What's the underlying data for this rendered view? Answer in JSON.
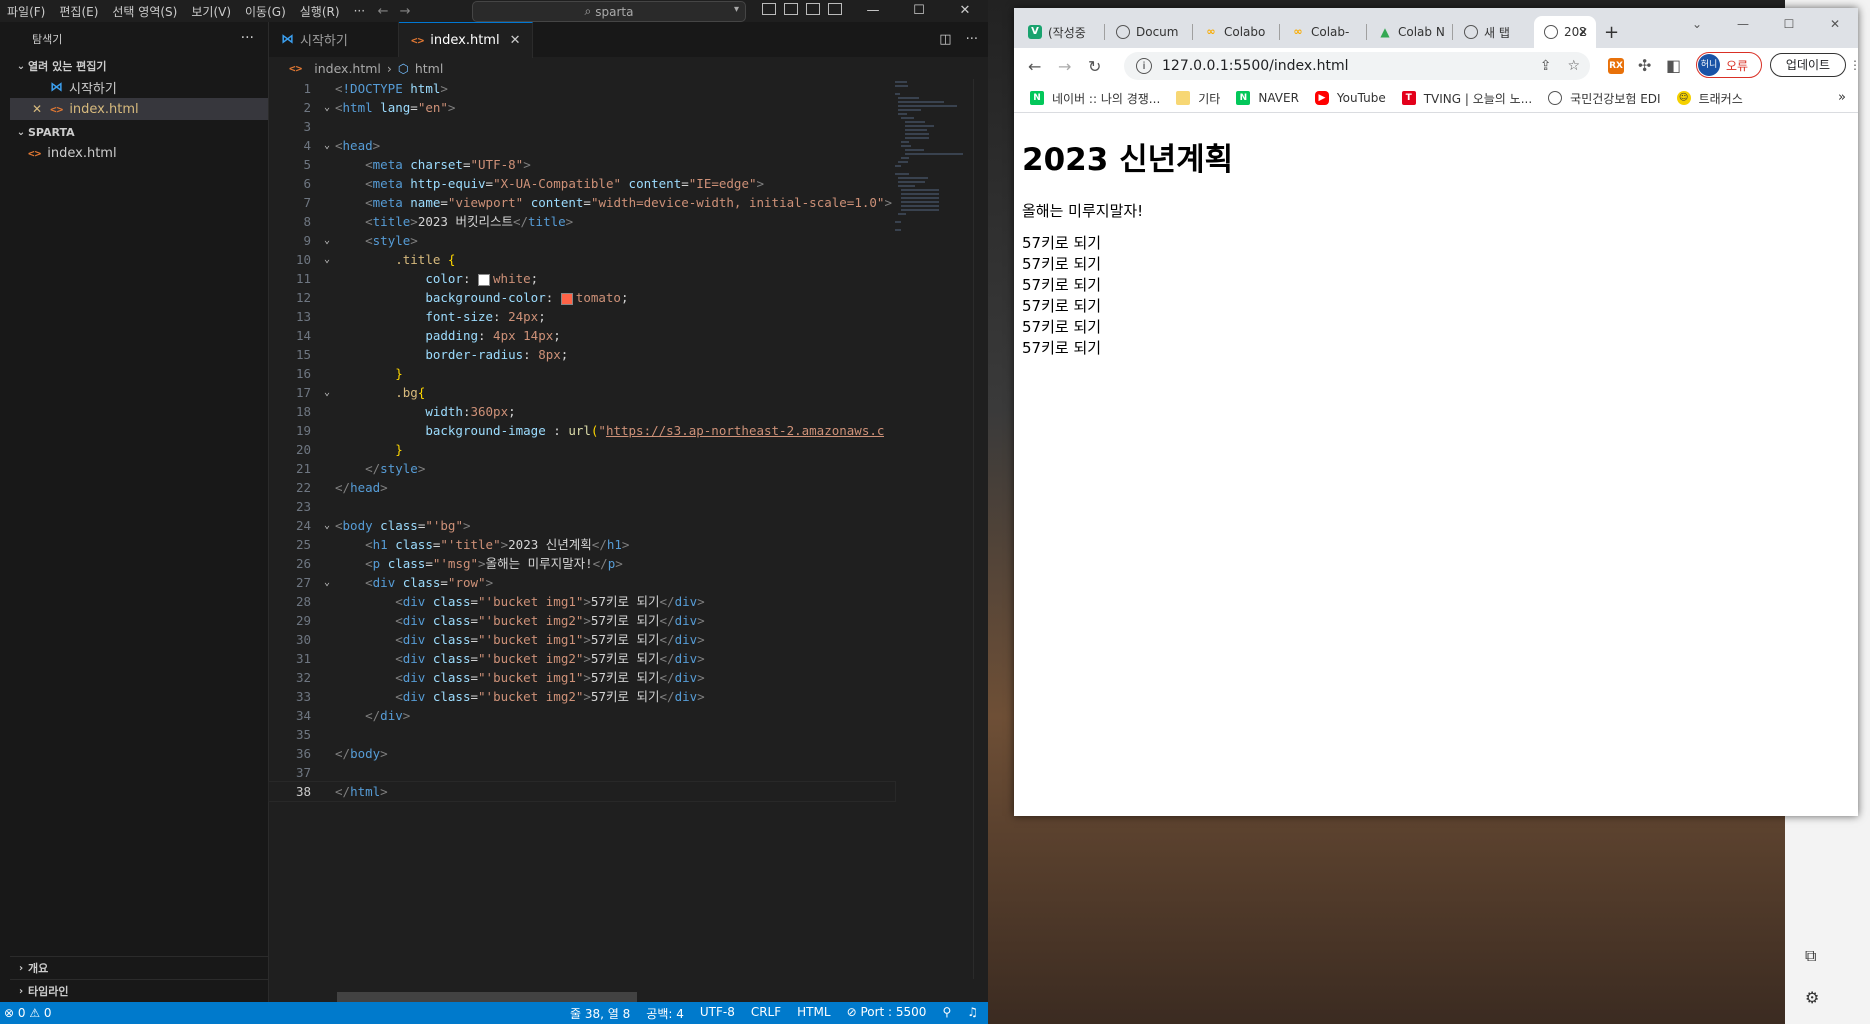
{
  "vscode": {
    "menus": [
      "파일(F)",
      "편집(E)",
      "선택 영역(S)",
      "보기(V)",
      "이동(G)",
      "실행(R)",
      "···"
    ],
    "search_text": "sparta",
    "sidebar": {
      "title": "탐색기",
      "open_editors_label": "열려 있는 편집기",
      "open_editors": [
        "시작하기",
        "index.html"
      ],
      "folder_label": "SPARTA",
      "folder_files": [
        "index.html"
      ],
      "bottom_sections": [
        "개요",
        "타임라인"
      ]
    },
    "tabs": [
      "시작하기",
      "index.html"
    ],
    "breadcrumb": [
      "index.html",
      "html"
    ],
    "code_lines": [
      "<!DOCTYPE html>",
      "<html lang=\"en\">",
      "",
      "<head>",
      "    <meta charset=\"UTF-8\">",
      "    <meta http-equiv=\"X-UA-Compatible\" content=\"IE=edge\">",
      "    <meta name=\"viewport\" content=\"width=device-width, initial-scale=1.0\">",
      "    <title>2023 버킷리스트</title>",
      "    <style>",
      "        .title {",
      "            color: white;",
      "            background-color: tomato;",
      "            font-size: 24px;",
      "            padding: 4px 14px;",
      "            border-radius: 8px;",
      "        }",
      "        .bg{",
      "            width:360px;",
      "            background-image : url(\"https://s3.ap-northeast-2.amazonaws.c",
      "        }",
      "    </style>",
      "</head>",
      "",
      "<body class=\"'bg\">",
      "    <h1 class=\"'title\">2023 신년계획</h1>",
      "    <p class=\"'msg\">올해는 미루지말자!</p>",
      "    <div class=\"row\">",
      "        <div class=\"'bucket img1\">57키로 되기</div>",
      "        <div class=\"'bucket img2\">57키로 되기</div>",
      "        <div class=\"'bucket img1\">57키로 되기</div>",
      "        <div class=\"'bucket img2\">57키로 되기</div>",
      "        <div class=\"'bucket img1\">57키로 되기</div>",
      "        <div class=\"'bucket img2\">57키로 되기</div>",
      "    </div>",
      "",
      "</body>",
      "",
      "</html>"
    ],
    "status": {
      "problems": "0",
      "position": "줄 38, 열 8",
      "spaces": "공백: 4",
      "encoding": "UTF-8",
      "eol": "CRLF",
      "language": "HTML",
      "port": "Port : 5500"
    }
  },
  "chrome": {
    "tabs": [
      "(작성중",
      "Docum",
      "Colabo",
      "Colab-",
      "Colab N",
      "새 탭",
      "202"
    ],
    "url": "127.0.0.1:5500/index.html",
    "profile_initials": "허니",
    "profile_status": "오류",
    "update_label": "업데이트",
    "bookmarks": [
      "네이버 :: 나의 경쟁...",
      "기타",
      "NAVER",
      "YouTube",
      "TVING | 오늘의 노...",
      "국민건강보험 EDI",
      "트래커스"
    ],
    "page": {
      "title": "2023 신년계획",
      "msg": "올해는 미루지말자!",
      "buckets": [
        "57키로 되기",
        "57키로 되기",
        "57키로 되기",
        "57키로 되기",
        "57키로 되기",
        "57키로 되기"
      ]
    }
  },
  "colors": {
    "accent": "#007acc",
    "tomato": "#ff6347"
  }
}
